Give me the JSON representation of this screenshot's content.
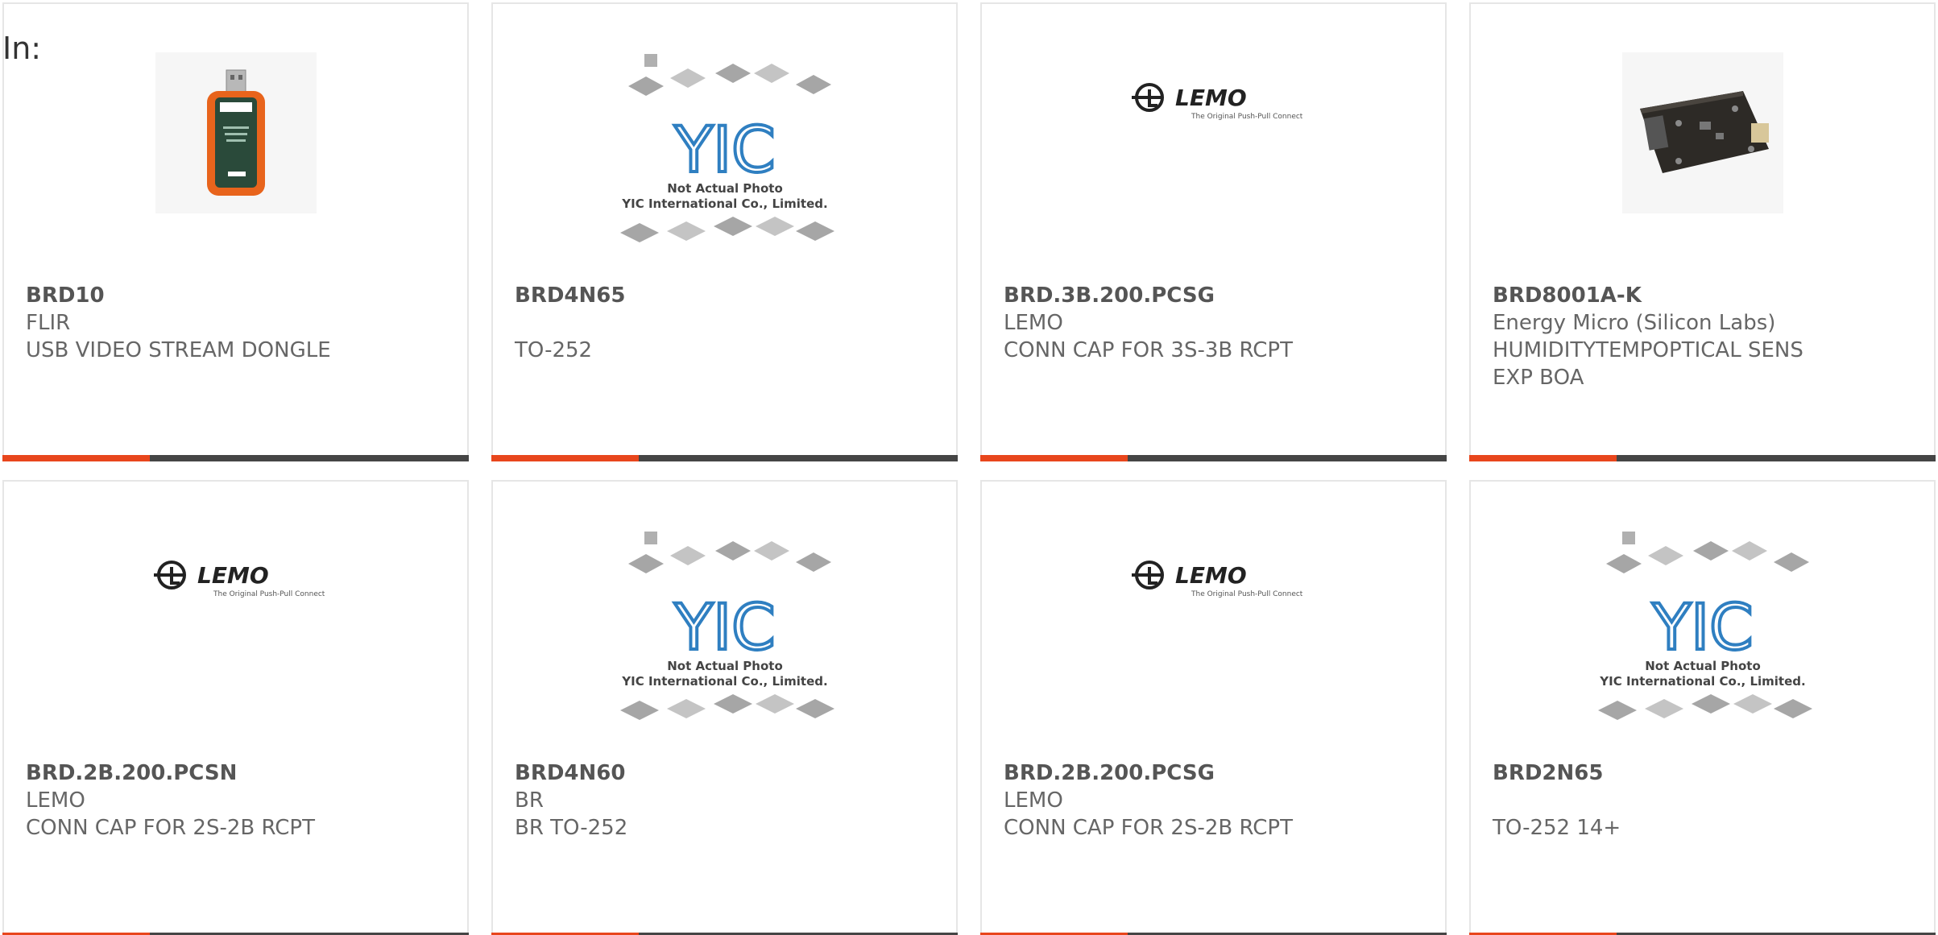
{
  "page": {
    "prefix_label": "In:"
  },
  "colors": {
    "accent": "#e8461c",
    "bar": "#454545",
    "border": "#e6e6e6",
    "text": "#666666"
  },
  "cards": [
    {
      "part_number": "BRD10",
      "manufacturer": "FLIR",
      "description": "USB VIDEO STREAM DONGLE",
      "image": "usb-dongle-photo"
    },
    {
      "part_number": "BRD4N65",
      "manufacturer": "",
      "description": "TO-252",
      "image": "yic-placeholder"
    },
    {
      "part_number": "BRD.3B.200.PCSG",
      "manufacturer": "LEMO",
      "description": "CONN CAP FOR 3S-3B RCPT",
      "image": "lemo-logo"
    },
    {
      "part_number": "BRD8001A-K",
      "manufacturer": "Energy Micro (Silicon Labs)",
      "description": "HUMIDITYTEMPOPTICAL SENS",
      "description2": "EXP BOA",
      "image": "pcb-board-photo"
    },
    {
      "part_number": "BRD.2B.200.PCSN",
      "manufacturer": "LEMO",
      "description": "CONN CAP FOR 2S-2B RCPT",
      "image": "lemo-logo"
    },
    {
      "part_number": "BRD4N60",
      "manufacturer": "BR",
      "description": "BR TO-252",
      "image": "yic-placeholder"
    },
    {
      "part_number": "BRD.2B.200.PCSG",
      "manufacturer": "LEMO",
      "description": "CONN CAP FOR 2S-2B RCPT",
      "image": "lemo-logo"
    },
    {
      "part_number": "BRD2N65",
      "manufacturer": "",
      "description": "TO-252 14+",
      "image": "yic-placeholder"
    }
  ],
  "yic": {
    "line1": "Not Actual Photo",
    "line2": "YIC International Co., Limited.",
    "logo": "YIC"
  },
  "lemo": {
    "name": "LEMO",
    "tagline": "The Original Push-Pull Connector"
  }
}
